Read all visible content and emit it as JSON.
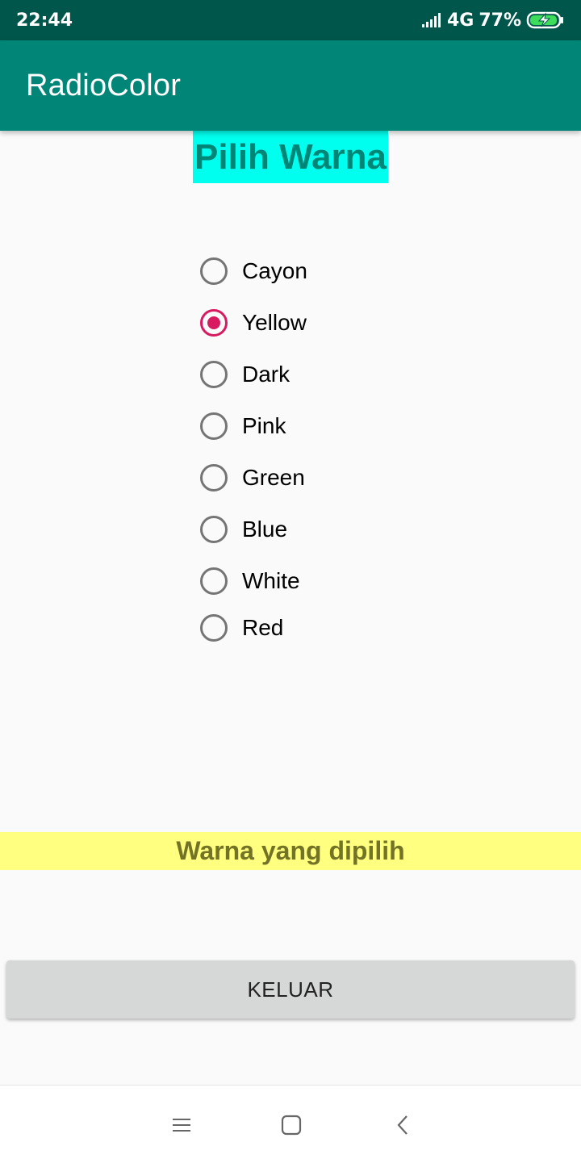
{
  "status_bar": {
    "time": "22:44",
    "network": "4G",
    "battery": "77%",
    "icons": [
      "signal-icon",
      "battery-charging-icon"
    ]
  },
  "app_bar": {
    "title": "RadioColor"
  },
  "heading": {
    "text": "Pilih Warna"
  },
  "radio_group": {
    "selected_index": 1,
    "options": [
      "Cayon",
      "Yellow",
      "Dark",
      "Pink",
      "Green",
      "Blue",
      "White",
      "Red"
    ]
  },
  "result": {
    "text": "Warna yang dipilih"
  },
  "exit_button": {
    "label": "KELUAR"
  },
  "nav_bar": {
    "icons": [
      "menu-icon",
      "home-icon",
      "back-icon"
    ]
  },
  "colors": {
    "status_bar": "#00564a",
    "app_bar": "#008577",
    "heading_bg": "#00ffee",
    "heading_text": "#008577",
    "radio_accent": "#d81b60",
    "result_bg": "#ffff80",
    "button_bg": "#d6d7d7"
  }
}
